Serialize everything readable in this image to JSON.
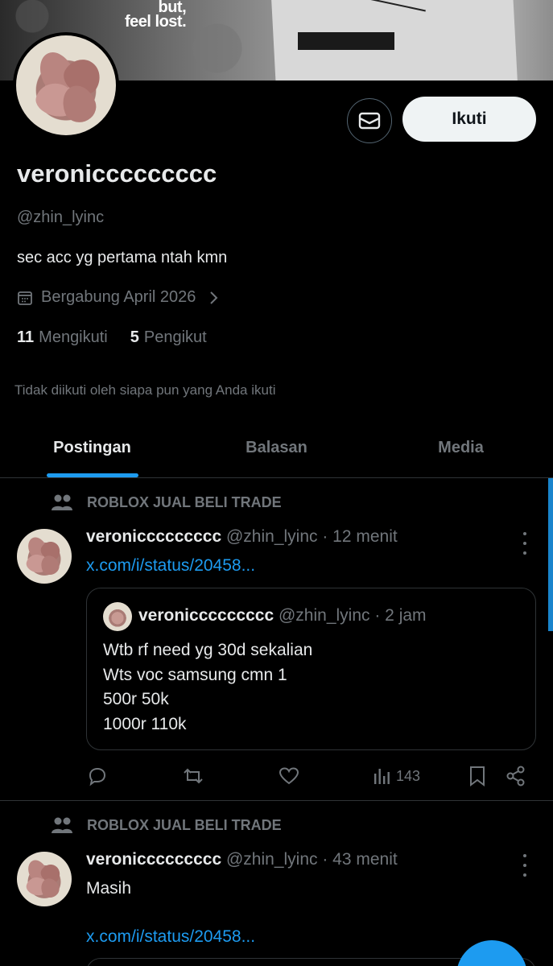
{
  "banner": {
    "text_line1": "but,",
    "text_line2": "feel lost."
  },
  "profile": {
    "display_name": "veroniccccccccc",
    "handle": "@zhin_lyinc",
    "bio": "sec acc yg pertama ntah kmn",
    "joined": "Bergabung April 2026",
    "following_count": "11",
    "following_label": "Mengikuti",
    "followers_count": "5",
    "followers_label": "Pengikut",
    "not_followed_text": "Tidak diikuti oleh siapa pun yang Anda ikuti",
    "follow_button": "Ikuti"
  },
  "tabs": [
    {
      "label": "Postingan",
      "active": true
    },
    {
      "label": "Balasan",
      "active": false
    },
    {
      "label": "Media",
      "active": false
    }
  ],
  "posts": [
    {
      "community": "ROBLOX JUAL BELI TRADE",
      "name": "veroniccccccccc",
      "meta": "@zhin_lyinc · 12 menit",
      "link": "x.com/i/status/20458...",
      "quote": {
        "name": "veroniccccccccc",
        "meta": "@zhin_lyinc · 2 jam",
        "lines": [
          "Wtb rf need yg 30d sekalian",
          "Wts voc samsung cmn 1",
          "500r 50k",
          "1000r 110k"
        ]
      },
      "views": "143"
    },
    {
      "community": "ROBLOX JUAL BELI TRADE",
      "name": "veroniccccccccc",
      "meta": "@zhin_lyinc · 43 menit",
      "text": "Masih",
      "link": "x.com/i/status/20458..."
    }
  ],
  "colors": {
    "accent": "#1d9bf0",
    "muted": "#71767b",
    "text": "#e7e9ea",
    "border": "#2f3336"
  }
}
